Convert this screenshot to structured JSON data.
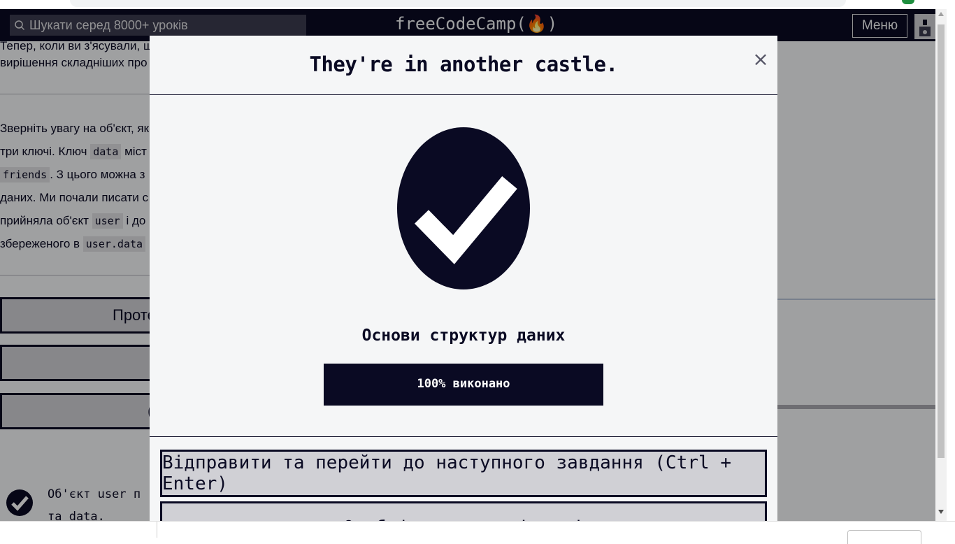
{
  "nav": {
    "search_placeholder": "Шукати серед 8000+ уроків",
    "brand": "freeCodeCamp(🔥)",
    "menu_label": "Меню"
  },
  "lesson": {
    "line_partial": "Тепер, коли ви з'ясували, що...",
    "line2": "вирішення складніших про",
    "para": [
      [
        "Зверніть увагу на об'єкт, як"
      ],
      [
        "три ключі. Ключ ",
        "data",
        " міст"
      ],
      [
        "",
        "friends",
        ". З цього можна з"
      ],
      [
        "даних. Ми почали писати с"
      ],
      [
        "прийняла об'єкт ",
        "user",
        " і до"
      ],
      [
        "збереженого в ",
        "user.data"
      ]
    ],
    "buttons": [
      "Проте",
      "",
      "("
    ],
    "test": {
      "line1": "Об'єкт user п",
      "line2": "та data."
    }
  },
  "modal": {
    "title": "They're in another castle.",
    "close": "×",
    "block_name": "Основи структур даних",
    "progress_percent": 100,
    "progress_label": "100% виконано",
    "submit_label": "Відправити та перейти до наступного завдання (Ctrl + Enter)",
    "second_label": "Опублікувати на форумі"
  },
  "colors": {
    "dark": "#0a0a23",
    "light": "#f5f6f7",
    "button_bg": "#d0d0d5"
  }
}
